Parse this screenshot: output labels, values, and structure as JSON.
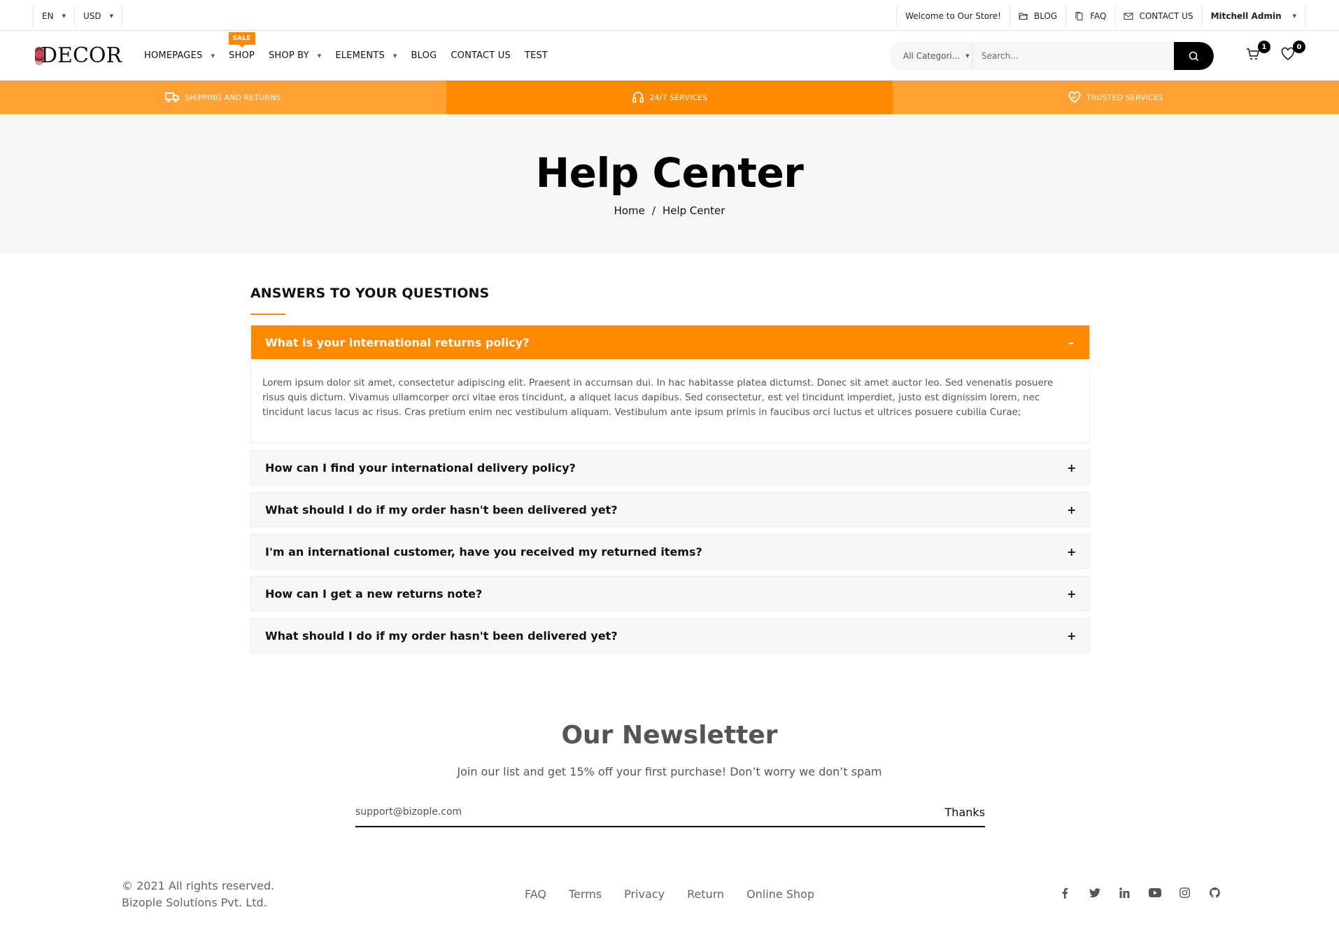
{
  "topbar": {
    "language": "EN",
    "currency": "USD",
    "welcome": "Welcome to Our Store!",
    "links": [
      {
        "label": "BLOG",
        "icon": "folder-icon"
      },
      {
        "label": "FAQ",
        "icon": "copy-icon"
      },
      {
        "label": "CONTACT US",
        "icon": "mail-icon"
      }
    ],
    "user": "Mitchell Admin"
  },
  "header": {
    "logo": "DECOR",
    "nav": [
      {
        "label": "HOMEPAGES",
        "dropdown": true
      },
      {
        "label": "SHOP",
        "dropdown": false,
        "badge": "SALE"
      },
      {
        "label": "SHOP BY",
        "dropdown": true
      },
      {
        "label": "ELEMENTS",
        "dropdown": true
      },
      {
        "label": "BLOG",
        "dropdown": false
      },
      {
        "label": "CONTACT US",
        "dropdown": false
      },
      {
        "label": "TEST",
        "dropdown": false
      }
    ],
    "search": {
      "category": "All Categori...",
      "placeholder": "Search..."
    },
    "cart_count": "1",
    "wishlist_count": "0"
  },
  "features": [
    {
      "label": "SHIPPING AND RETURNS",
      "icon": "truck-icon"
    },
    {
      "label": "24/7 SERVICES",
      "icon": "headphones-icon"
    },
    {
      "label": "TRUSTED SERVICES",
      "icon": "handshake-heart-icon"
    }
  ],
  "colors": {
    "accent": "#ff8a00",
    "accent_light": "#ffa233"
  },
  "hero": {
    "title": "Help Center",
    "breadcrumb": [
      "Home",
      "/",
      "Help Center"
    ]
  },
  "faq": {
    "title": "ANSWERS TO YOUR QUESTIONS",
    "items": [
      {
        "question": "What is your international returns policy?",
        "open": true,
        "toggle": "–",
        "answer": "Lorem ipsum dolor sit amet, consectetur adipiscing elit. Praesent in accumsan dui. In hac habitasse platea dictumst. Donec sit amet auctor leo. Sed venenatis posuere risus quis dictum. Vivamus ullamcorper orci vitae eros tincidunt, a aliquet lacus dapibus. Sed consectetur, est vel tincidunt imperdiet, justo est dignissim lorem, nec tincidunt lacus lacus ac risus. Cras pretium enim nec vestibulum aliquam. Vestibulum ante ipsum primis in faucibus orci luctus et ultrices posuere cubilia Curae;"
      },
      {
        "question": "How can I find your international delivery policy?",
        "open": false,
        "toggle": "+"
      },
      {
        "question": "What should I do if my order hasn't been delivered yet?",
        "open": false,
        "toggle": "+"
      },
      {
        "question": "I'm an international customer, have you received my returned items?",
        "open": false,
        "toggle": "+"
      },
      {
        "question": "How can I get a new returns note?",
        "open": false,
        "toggle": "+"
      },
      {
        "question": "What should I do if my order hasn't been delivered yet?",
        "open": false,
        "toggle": "+"
      }
    ]
  },
  "newsletter": {
    "title": "Our Newsletter",
    "subtitle": "Join our list and get 15% off your first purchase! Don’t worry we don’t spam",
    "email_value": "support@bizople.com",
    "button": "Thanks"
  },
  "footer": {
    "copyright": "© 2021 All rights reserved.",
    "company": "Bizople Solutions Pvt. Ltd.",
    "links": [
      "FAQ",
      "Terms",
      "Privacy",
      "Return",
      "Online Shop"
    ],
    "socials": [
      "facebook-icon",
      "twitter-icon",
      "linkedin-icon",
      "youtube-icon",
      "instagram-icon",
      "github-icon"
    ]
  }
}
